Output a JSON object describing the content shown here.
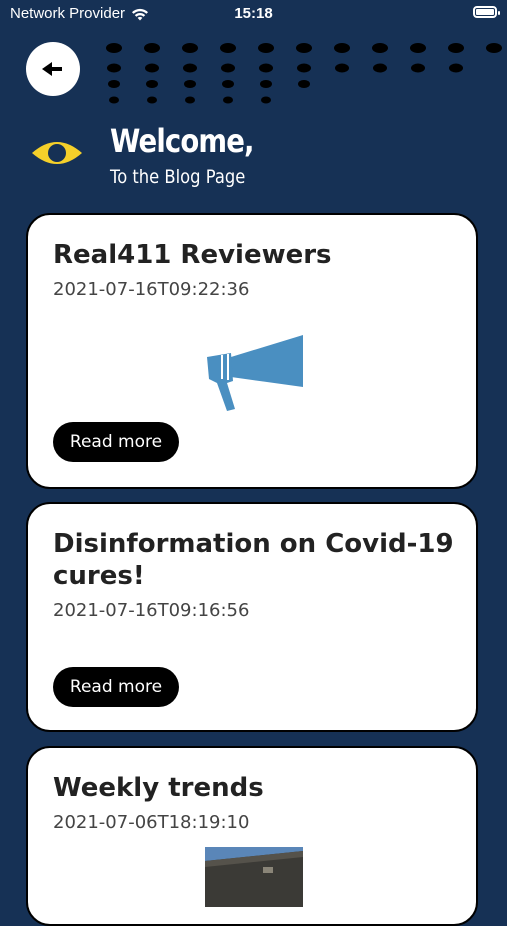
{
  "status_bar": {
    "carrier": "Network Provider",
    "time": "15:18"
  },
  "header": {
    "title": "Welcome,",
    "subtitle": "To the Blog Page"
  },
  "posts": [
    {
      "title": "Real411 Reviewers",
      "date": "2021-07-16T09:22:36",
      "button": "Read more",
      "image": "megaphone-image"
    },
    {
      "title": "Disinformation on Covid-19 cures!",
      "date": "2021-07-16T09:16:56",
      "button": "Read more"
    },
    {
      "title": "Weekly trends",
      "date": "2021-07-06T18:19:10",
      "image": "building-photo"
    }
  ],
  "colors": {
    "background": "#163155",
    "card": "#ffffff",
    "accent_yellow": "#f5d02a",
    "megaphone_blue": "#4a8fc1",
    "button": "#000000"
  }
}
